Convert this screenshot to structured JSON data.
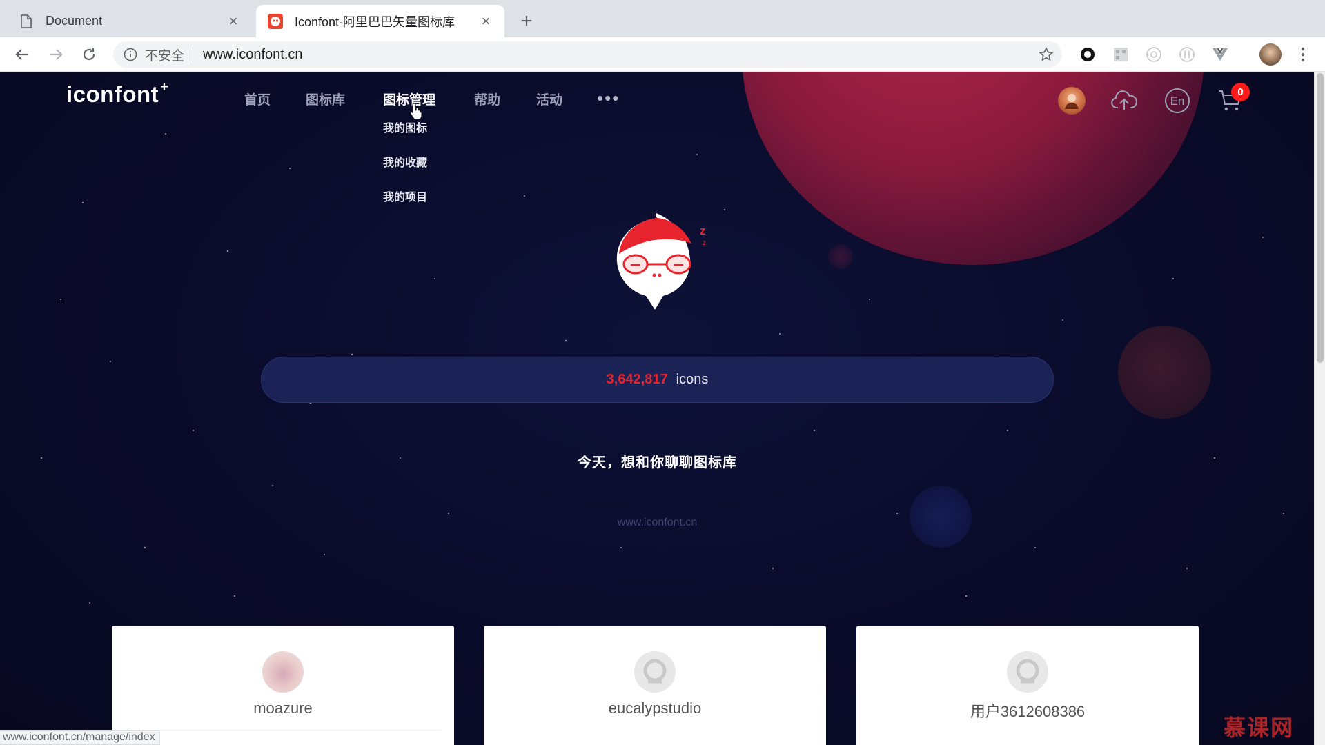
{
  "browser": {
    "tabs": [
      {
        "title": "Document",
        "active": false
      },
      {
        "title": "Iconfont-阿里巴巴矢量图标库",
        "active": true
      }
    ],
    "address": {
      "security_label": "不安全",
      "url": "www.iconfont.cn"
    },
    "status_url": "www.iconfont.cn/manage/index"
  },
  "site": {
    "logo": "iconfont",
    "logo_plus": "+",
    "nav": [
      "首页",
      "图标库",
      "图标管理",
      "帮助",
      "活动"
    ],
    "nav_more": "•••",
    "dropdown": [
      "我的图标",
      "我的收藏",
      "我的项目"
    ],
    "cart_count": "0",
    "lang": "En"
  },
  "hero": {
    "icon_count": "3,642,817",
    "icon_unit": "icons",
    "slogan": "今天，想和你聊聊图标库",
    "url_watermark": "www.iconfont.cn"
  },
  "cards": [
    {
      "name": "moazure",
      "avatar": "photo"
    },
    {
      "name": "eucalypstudio",
      "avatar": "default"
    },
    {
      "name": "用户3612608386",
      "avatar": "default"
    }
  ],
  "corner_watermark": "慕课网",
  "colors": {
    "accent": "#e8242f",
    "background": "#0a0b2a",
    "planet": "#8a1a3d"
  }
}
